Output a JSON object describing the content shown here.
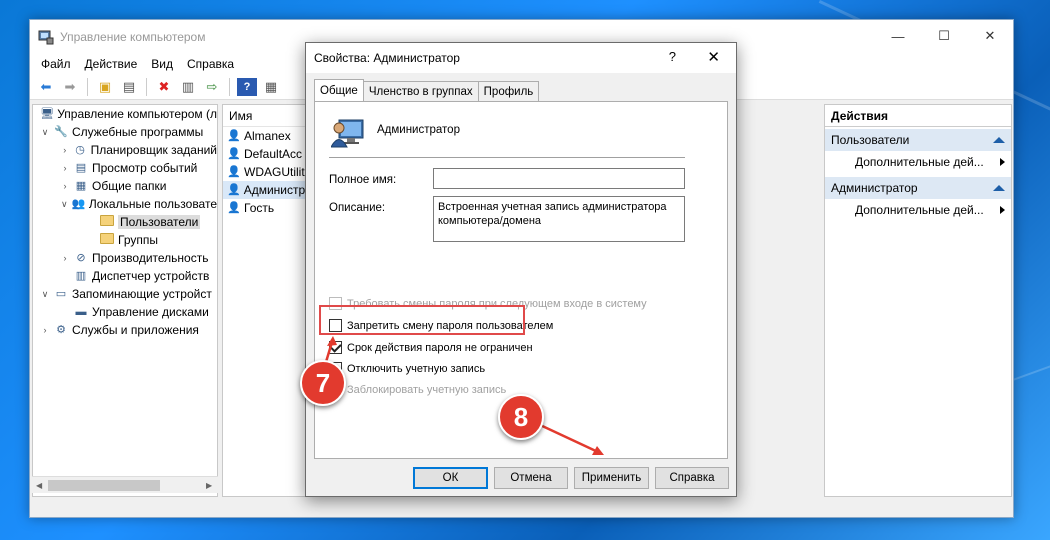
{
  "window": {
    "title": "Управление компьютером",
    "controls": [
      "—",
      "☐",
      "✕"
    ]
  },
  "menu": [
    "Файл",
    "Действие",
    "Вид",
    "Справка"
  ],
  "tree": [
    {
      "label": "Управление компьютером (л",
      "exp": "",
      "icon": "computer-icon",
      "level": 0
    },
    {
      "label": "Служебные программы",
      "exp": "∨",
      "icon": "tools-icon",
      "level": 1
    },
    {
      "label": "Планировщик заданий",
      "exp": "›",
      "icon": "clock-icon",
      "level": 2
    },
    {
      "label": "Просмотр событий",
      "exp": "›",
      "icon": "event-viewer-icon",
      "level": 2
    },
    {
      "label": "Общие папки",
      "exp": "›",
      "icon": "shared-folder-icon",
      "level": 2
    },
    {
      "label": "Локальные пользовате",
      "exp": "∨",
      "icon": "users-icon",
      "level": 2
    },
    {
      "label": "Пользователи",
      "exp": "",
      "icon": "folder-icon",
      "level": 3,
      "selected": true
    },
    {
      "label": "Группы",
      "exp": "",
      "icon": "folder-icon",
      "level": 3
    },
    {
      "label": "Производительность",
      "exp": "›",
      "icon": "performance-icon",
      "level": 2
    },
    {
      "label": "Диспетчер устройств",
      "exp": "",
      "icon": "device-manager-icon",
      "level": 2
    },
    {
      "label": "Запоминающие устройст",
      "exp": "∨",
      "icon": "storage-icon",
      "level": 1
    },
    {
      "label": "Управление дисками",
      "exp": "",
      "icon": "disk-icon",
      "level": 2
    },
    {
      "label": "Службы и приложения",
      "exp": "›",
      "icon": "services-icon",
      "level": 1
    }
  ],
  "list": {
    "header": "Имя",
    "rows": [
      {
        "label": "Almanex",
        "selected": false
      },
      {
        "label": "DefaultAcc",
        "selected": false
      },
      {
        "label": "WDAGUtilit",
        "selected": false
      },
      {
        "label": "Администра",
        "selected": true
      },
      {
        "label": "Гость",
        "selected": false
      }
    ]
  },
  "actions": {
    "header": "Действия",
    "groups": [
      {
        "title": "Пользователи",
        "item": "Дополнительные дей..."
      },
      {
        "title": "Администратор",
        "item": "Дополнительные дей..."
      }
    ]
  },
  "dialog": {
    "title": "Свойства: Администратор",
    "help": "?",
    "close": "✕",
    "tabs": [
      "Общие",
      "Членство в группах",
      "Профиль"
    ],
    "user_name": "Администратор",
    "full_name_label": "Полное имя:",
    "full_name_value": "",
    "description_label": "Описание:",
    "description_value": "Встроенная учетная запись администратора компьютера/домена",
    "checkboxes": [
      {
        "label": "Требовать смены пароля при следующем входе в систему",
        "checked": false,
        "disabled": true
      },
      {
        "label": "Запретить смену пароля пользователем",
        "checked": false,
        "disabled": false
      },
      {
        "label": "Срок действия пароля не ограничен",
        "checked": true,
        "disabled": false
      },
      {
        "label": "Отключить учетную запись",
        "checked": false,
        "disabled": false
      },
      {
        "label": "Заблокировать учетную запись",
        "checked": false,
        "disabled": true
      }
    ],
    "buttons": {
      "ok": "ОК",
      "cancel": "Отмена",
      "apply": "Применить",
      "help": "Справка"
    }
  },
  "annotations": {
    "step7": "7",
    "step8": "8",
    "color": "#e23a2e"
  }
}
